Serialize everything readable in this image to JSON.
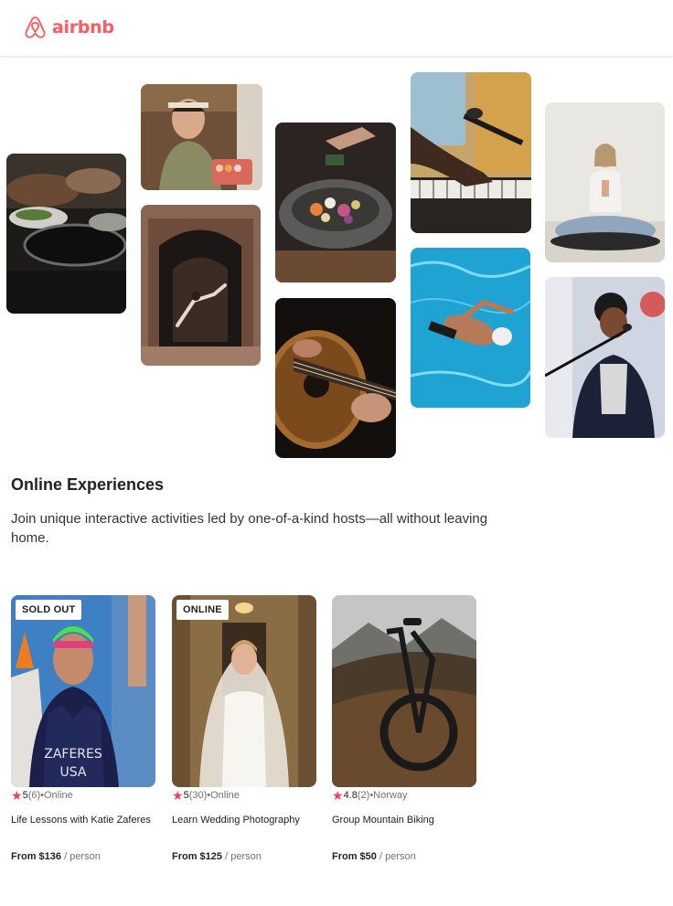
{
  "header": {
    "logo_text": "airbnb",
    "logo_icon": "airbnb-belo-icon",
    "brand_color": "#FF5A5F"
  },
  "photos": [
    {
      "name": "cooking-pans",
      "subject": "cooking-photo"
    },
    {
      "name": "macarons-host",
      "subject": "food-host-photo"
    },
    {
      "name": "dancer-doorway",
      "subject": "dance-photo"
    },
    {
      "name": "salad-bowl",
      "subject": "food-bowl-photo"
    },
    {
      "name": "guitar-player",
      "subject": "guitar-photo"
    },
    {
      "name": "piano-microphone",
      "subject": "piano-photo"
    },
    {
      "name": "swimmer-pool",
      "subject": "swimming-photo"
    },
    {
      "name": "meditation",
      "subject": "yoga-photo"
    },
    {
      "name": "singer",
      "subject": "singer-photo"
    }
  ],
  "section": {
    "title": "Online Experiences",
    "description": "Join unique interactive activities led by one-of-a-kind hosts—all without leaving home."
  },
  "experiences": [
    {
      "badge": "SOLD OUT",
      "score": "5",
      "reviews": "(6)",
      "location": " •Online",
      "title": "Life Lessons with Katie Zaferes",
      "price_bold": "From $136",
      "price_unit": " / person"
    },
    {
      "badge": "ONLINE",
      "score": "5",
      "reviews": "(30)",
      "location": " •Online",
      "title": "Learn Wedding Photography",
      "price_bold": "From $125",
      "price_unit": " / person"
    },
    {
      "badge": "",
      "score": "4.8",
      "reviews": "(2)",
      "location": " •Norway",
      "title": "Group Mountain Biking",
      "price_bold": "From $50",
      "price_unit": " / person"
    }
  ],
  "colors": {
    "star": "#FF385C",
    "muted_text": "#717171"
  }
}
